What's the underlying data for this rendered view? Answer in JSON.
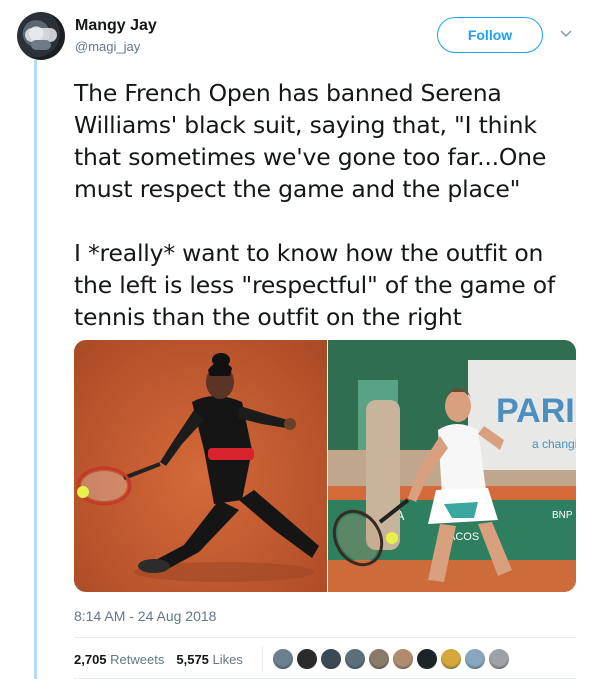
{
  "tweet": {
    "author_name": "Mangy Jay",
    "author_handle": "@magi_jay",
    "follow_label": "Follow",
    "text": "The French Open has banned Serena Williams' black suit, saying that, \"I think that sometimes we've gone too far...One must respect the game and the place\"\n\nI *really* want to know how the outfit on the left is less \"respectful\" of the game of tennis than the outfit on the right",
    "timestamp": "8:14 AM - 24 Aug 2018",
    "retweets_count": "2,705",
    "retweets_label": "Retweets",
    "likes_count": "5,575",
    "likes_label": "Likes",
    "right_photo_signage": [
      "PARI",
      "a changi",
      "PA",
      "ACOS",
      "BNP"
    ]
  },
  "colors": {
    "accent": "#1da1f2",
    "text": "#14171a",
    "secondary": "#657786",
    "thread_line": "#b6dcf4"
  },
  "likers": [
    "#6b7f8c",
    "#2a2a2a",
    "#3c4a55",
    "#5b6e7a",
    "#8a7a6a",
    "#b08b6e",
    "#1d2428",
    "#d4a83a",
    "#88a6c0",
    "#9ea2a6"
  ]
}
